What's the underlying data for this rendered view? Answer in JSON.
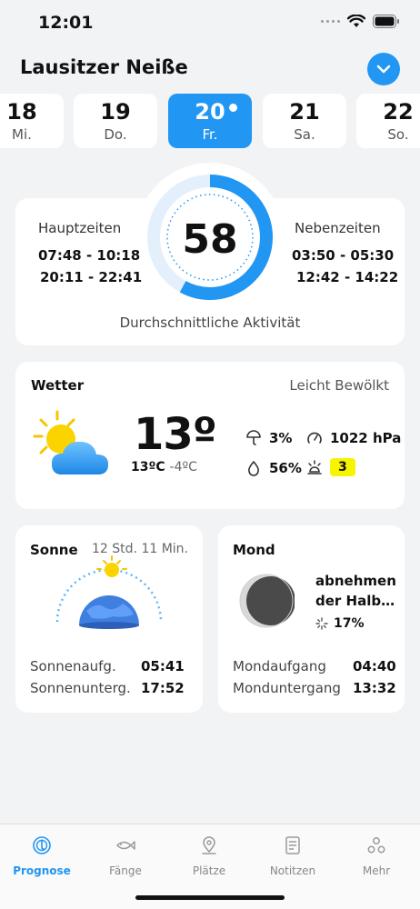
{
  "status": {
    "time": "12:01"
  },
  "header": {
    "title": "Lausitzer Neiße"
  },
  "dates": [
    {
      "day": "18",
      "weekday": "Mi.",
      "active": false
    },
    {
      "day": "19",
      "weekday": "Do.",
      "active": false
    },
    {
      "day": "20",
      "weekday": "Fr.",
      "active": true
    },
    {
      "day": "21",
      "weekday": "Sa.",
      "active": false
    },
    {
      "day": "22",
      "weekday": "So.",
      "active": false
    }
  ],
  "activity": {
    "score": "58",
    "score_fraction": 0.58,
    "major_title": "Hauptzeiten",
    "major_times": [
      "07:48 - 10:18",
      "20:11 - 22:41"
    ],
    "minor_title": "Nebenzeiten",
    "minor_times": [
      "03:50 - 05:30",
      "12:42 - 14:22"
    ],
    "label": "Durchschnittliche Aktivität"
  },
  "weather": {
    "title": "Wetter",
    "condition": "Leicht Bewölkt",
    "temp": "13º",
    "temp_high": "13ºC",
    "temp_low": "-4ºC",
    "rain": "3%",
    "pressure": "1022 hPa",
    "humidity": "56%",
    "bite_index": "3"
  },
  "sun": {
    "title": "Sonne",
    "duration": "12 Std. 11 Min.",
    "sunrise_label": "Sonnenaufg.",
    "sunrise": "05:41",
    "sunset_label": "Sonnenunterg.",
    "sunset": "17:52"
  },
  "moon": {
    "title": "Mond",
    "phase": "abnehmen der Halb…",
    "illumination": "17%",
    "moonrise_label": "Mondaufgang",
    "moonrise": "04:40",
    "moonset_label": "Monduntergang",
    "moonset": "13:32"
  },
  "tabs": [
    {
      "label": "Prognose",
      "active": true
    },
    {
      "label": "Fänge",
      "active": false
    },
    {
      "label": "Plätze",
      "active": false
    },
    {
      "label": "Notitzen",
      "active": false
    },
    {
      "label": "Mehr",
      "active": false
    }
  ],
  "colors": {
    "accent": "#2196f3",
    "badge": "#f5f500",
    "background": "#f2f3f5"
  }
}
